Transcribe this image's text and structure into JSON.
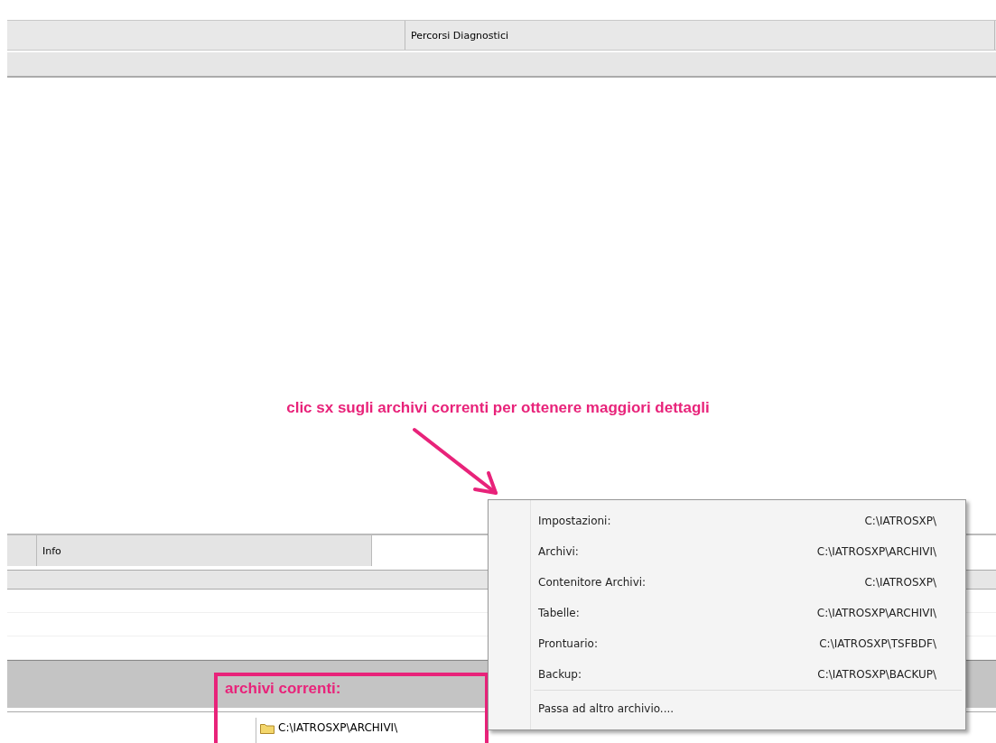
{
  "top_header": {
    "column_2": "Percorsi Diagnostici"
  },
  "bottom_header": {
    "column_2": "Info"
  },
  "current_archive": {
    "path": "C:\\IATROSXP\\ARCHIVI\\"
  },
  "annotation": {
    "note": "clic sx sugli archivi correnti per ottenere maggiori dettagli",
    "box_label": "archivi correnti:"
  },
  "context_menu": {
    "items": [
      {
        "label": "Impostazioni:",
        "path": "C:\\IATROSXP\\"
      },
      {
        "label": "Archivi:",
        "path": "C:\\IATROSXP\\ARCHIVI\\"
      },
      {
        "label": "Contenitore Archivi:",
        "path": "C:\\IATROSXP\\"
      },
      {
        "label": "Tabelle:",
        "path": "C:\\IATROSXP\\ARCHIVI\\"
      },
      {
        "label": "Prontuario:",
        "path": "C:\\IATROSXP\\TSFBDF\\"
      },
      {
        "label": "Backup:",
        "path": "C:\\IATROSXP\\BACKUP\\"
      }
    ],
    "action": "Passa ad altro archivio...."
  }
}
